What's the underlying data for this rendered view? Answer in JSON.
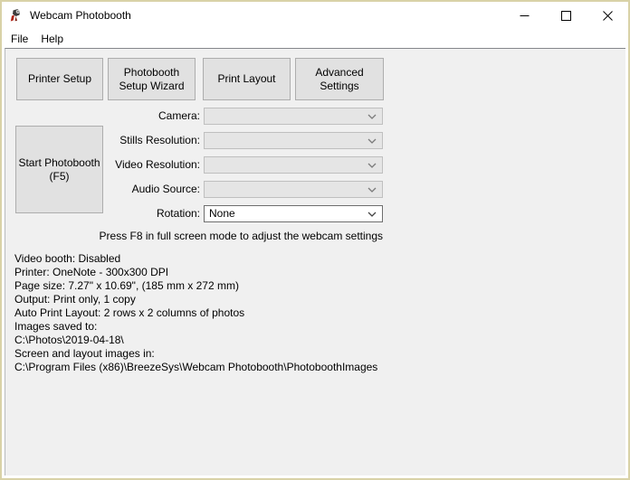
{
  "window": {
    "title": "Webcam Photobooth",
    "icons": {
      "app": "webcam-photobooth-app-icon",
      "minimize": "minimize-icon",
      "maximize": "maximize-icon",
      "close": "close-icon"
    }
  },
  "menu": {
    "items": [
      {
        "label": "File"
      },
      {
        "label": "Help"
      }
    ]
  },
  "toolbar": {
    "buttons": [
      {
        "label": "Printer Setup"
      },
      {
        "label": "Photobooth Setup Wizard"
      },
      {
        "label": "Print Layout"
      },
      {
        "label": "Advanced Settings"
      }
    ],
    "start_button": {
      "label": "Start Photobooth (F5)"
    }
  },
  "form": {
    "rows": [
      {
        "label": "Camera:",
        "value": "",
        "enabled": false
      },
      {
        "label": "Stills Resolution:",
        "value": "",
        "enabled": false
      },
      {
        "label": "Video Resolution:",
        "value": "",
        "enabled": false
      },
      {
        "label": "Audio Source:",
        "value": "",
        "enabled": false
      },
      {
        "label": "Rotation:",
        "value": "None",
        "enabled": true
      }
    ],
    "note": "Press F8 in full screen mode to adjust the webcam settings"
  },
  "status": {
    "lines": [
      "Video booth: Disabled",
      "Printer: OneNote - 300x300 DPI",
      "Page size: 7.27\" x 10.69\", (185 mm x 272 mm)",
      "Output: Print only, 1 copy",
      "Auto Print Layout: 2 rows x 2 columns of photos",
      "Images saved to:",
      "C:\\Photos\\2019-04-18\\",
      "Screen and layout images in:",
      "C:\\Program Files (x86)\\BreezeSys\\Webcam Photobooth\\PhotoboothImages"
    ]
  },
  "colors": {
    "window_border": "#d9d2a7",
    "titlebar_bg": "#ffffff",
    "client_bg": "#f0f0f0",
    "button_bg": "#e1e1e1",
    "button_border": "#adadad",
    "combo_disabled_bg": "#e5e5e5",
    "combo_disabled_border": "#bfbfbf",
    "combo_enabled_border": "#6e6e6e",
    "app_icon_red": "#b02418"
  }
}
